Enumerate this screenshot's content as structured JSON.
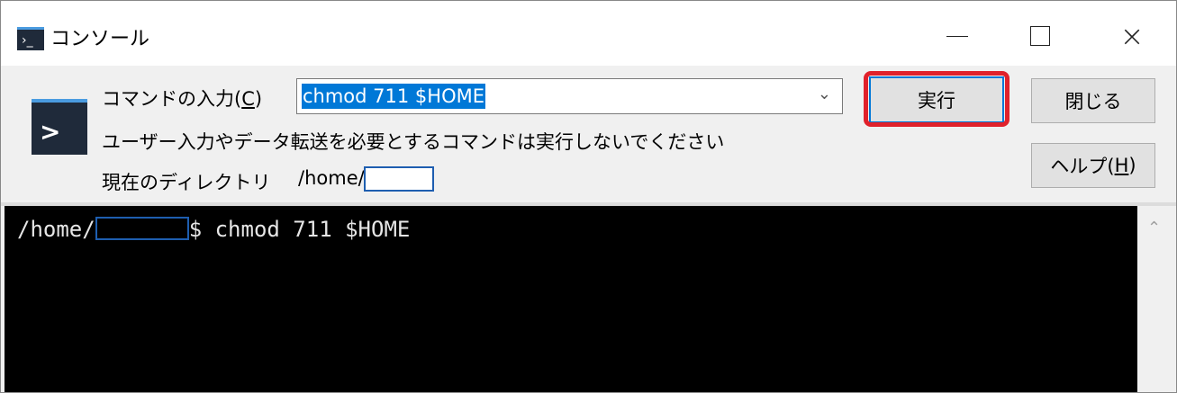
{
  "window": {
    "title": "コンソール",
    "controls": {
      "minimize": "—",
      "maximize": "",
      "close": "×"
    }
  },
  "form": {
    "command_label": "コマンドの入力(",
    "command_label_key": "C",
    "command_label_end": ")",
    "command_value": "chmod 711 $HOME",
    "warning_text": "ユーザー入力やデータ転送を必要とするコマンドは実行しないでください",
    "dir_label": "現在のディレクトリ",
    "dir_prefix": "/home/",
    "dir_user_masked": ""
  },
  "buttons": {
    "run": "実行",
    "close": "閉じる",
    "help_prefix": "ヘルプ(",
    "help_key": "H",
    "help_suffix": ")"
  },
  "console": {
    "prompt_path": "/home/",
    "prompt_user_masked": "",
    "prompt_symbol": "$",
    "command": " chmod 711 $HOME"
  },
  "colors": {
    "highlight": "#e0212b",
    "selection": "#0078d7",
    "console_bg": "#000000",
    "console_text": "#e6e6e6"
  },
  "icons": {
    "app": "console-app-icon",
    "prompt": "prompt-icon",
    "combo": "chevron-down-icon",
    "scroll": "scroll-up-icon"
  }
}
